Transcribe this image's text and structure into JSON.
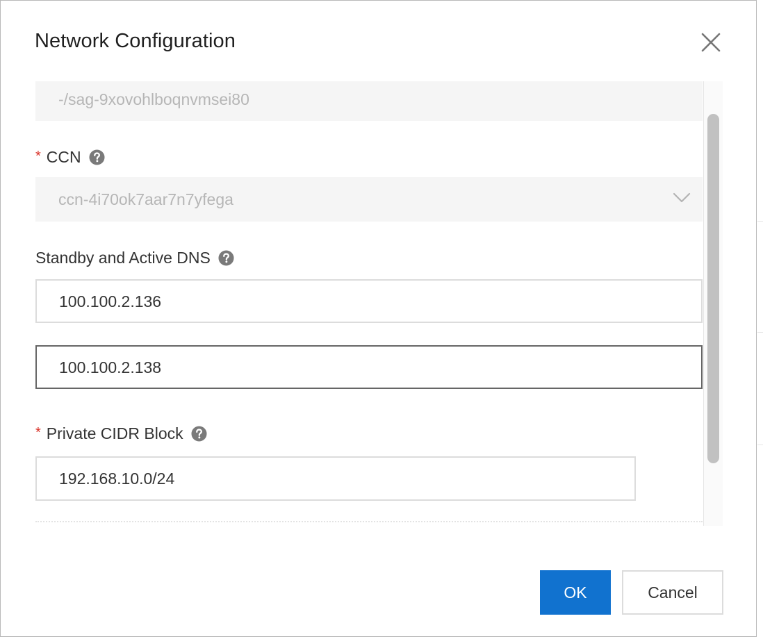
{
  "dialog": {
    "title": "Network Configuration"
  },
  "form": {
    "readonly_field": {
      "value": "-/sag-9xovohlboqnvmsei80"
    },
    "ccn": {
      "label": "CCN",
      "required": true,
      "selected_value": "ccn-4i70ok7aar7n7yfega"
    },
    "dns": {
      "label": "Standby and Active DNS",
      "primary_value": "100.100.2.136",
      "secondary_value": "100.100.2.138"
    },
    "cidr": {
      "label": "Private CIDR Block",
      "required": true,
      "value": "192.168.10.0/24"
    }
  },
  "footer": {
    "ok_label": "OK",
    "cancel_label": "Cancel"
  },
  "icons": {
    "close": "close-icon",
    "help": "question-circle-icon",
    "dropdown": "chevron-down-icon"
  },
  "colors": {
    "primary": "#1172cf",
    "required": "#d93026",
    "disabled_bg": "#f5f5f5",
    "disabled_text": "#b6b6b6"
  }
}
